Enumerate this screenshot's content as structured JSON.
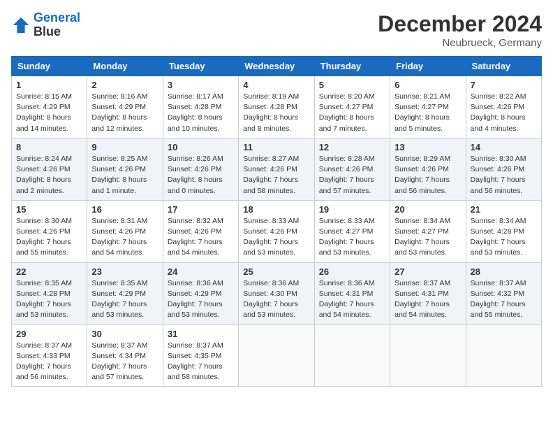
{
  "header": {
    "logo_line1": "General",
    "logo_line2": "Blue",
    "title": "December 2024",
    "subtitle": "Neubrueck, Germany"
  },
  "days_of_week": [
    "Sunday",
    "Monday",
    "Tuesday",
    "Wednesday",
    "Thursday",
    "Friday",
    "Saturday"
  ],
  "weeks": [
    [
      {
        "day": "1",
        "sunrise": "8:15 AM",
        "sunset": "4:29 PM",
        "daylight": "8 hours and 14 minutes."
      },
      {
        "day": "2",
        "sunrise": "8:16 AM",
        "sunset": "4:29 PM",
        "daylight": "8 hours and 12 minutes."
      },
      {
        "day": "3",
        "sunrise": "8:17 AM",
        "sunset": "4:28 PM",
        "daylight": "8 hours and 10 minutes."
      },
      {
        "day": "4",
        "sunrise": "8:19 AM",
        "sunset": "4:28 PM",
        "daylight": "8 hours and 8 minutes."
      },
      {
        "day": "5",
        "sunrise": "8:20 AM",
        "sunset": "4:27 PM",
        "daylight": "8 hours and 7 minutes."
      },
      {
        "day": "6",
        "sunrise": "8:21 AM",
        "sunset": "4:27 PM",
        "daylight": "8 hours and 5 minutes."
      },
      {
        "day": "7",
        "sunrise": "8:22 AM",
        "sunset": "4:26 PM",
        "daylight": "8 hours and 4 minutes."
      }
    ],
    [
      {
        "day": "8",
        "sunrise": "8:24 AM",
        "sunset": "4:26 PM",
        "daylight": "8 hours and 2 minutes."
      },
      {
        "day": "9",
        "sunrise": "8:25 AM",
        "sunset": "4:26 PM",
        "daylight": "8 hours and 1 minute."
      },
      {
        "day": "10",
        "sunrise": "8:26 AM",
        "sunset": "4:26 PM",
        "daylight": "8 hours and 0 minutes."
      },
      {
        "day": "11",
        "sunrise": "8:27 AM",
        "sunset": "4:26 PM",
        "daylight": "7 hours and 58 minutes."
      },
      {
        "day": "12",
        "sunrise": "8:28 AM",
        "sunset": "4:26 PM",
        "daylight": "7 hours and 57 minutes."
      },
      {
        "day": "13",
        "sunrise": "8:29 AM",
        "sunset": "4:26 PM",
        "daylight": "7 hours and 56 minutes."
      },
      {
        "day": "14",
        "sunrise": "8:30 AM",
        "sunset": "4:26 PM",
        "daylight": "7 hours and 56 minutes."
      }
    ],
    [
      {
        "day": "15",
        "sunrise": "8:30 AM",
        "sunset": "4:26 PM",
        "daylight": "7 hours and 55 minutes."
      },
      {
        "day": "16",
        "sunrise": "8:31 AM",
        "sunset": "4:26 PM",
        "daylight": "7 hours and 54 minutes."
      },
      {
        "day": "17",
        "sunrise": "8:32 AM",
        "sunset": "4:26 PM",
        "daylight": "7 hours and 54 minutes."
      },
      {
        "day": "18",
        "sunrise": "8:33 AM",
        "sunset": "4:26 PM",
        "daylight": "7 hours and 53 minutes."
      },
      {
        "day": "19",
        "sunrise": "8:33 AM",
        "sunset": "4:27 PM",
        "daylight": "7 hours and 53 minutes."
      },
      {
        "day": "20",
        "sunrise": "8:34 AM",
        "sunset": "4:27 PM",
        "daylight": "7 hours and 53 minutes."
      },
      {
        "day": "21",
        "sunrise": "8:34 AM",
        "sunset": "4:28 PM",
        "daylight": "7 hours and 53 minutes."
      }
    ],
    [
      {
        "day": "22",
        "sunrise": "8:35 AM",
        "sunset": "4:28 PM",
        "daylight": "7 hours and 53 minutes."
      },
      {
        "day": "23",
        "sunrise": "8:35 AM",
        "sunset": "4:29 PM",
        "daylight": "7 hours and 53 minutes."
      },
      {
        "day": "24",
        "sunrise": "8:36 AM",
        "sunset": "4:29 PM",
        "daylight": "7 hours and 53 minutes."
      },
      {
        "day": "25",
        "sunrise": "8:36 AM",
        "sunset": "4:30 PM",
        "daylight": "7 hours and 53 minutes."
      },
      {
        "day": "26",
        "sunrise": "8:36 AM",
        "sunset": "4:31 PM",
        "daylight": "7 hours and 54 minutes."
      },
      {
        "day": "27",
        "sunrise": "8:37 AM",
        "sunset": "4:31 PM",
        "daylight": "7 hours and 54 minutes."
      },
      {
        "day": "28",
        "sunrise": "8:37 AM",
        "sunset": "4:32 PM",
        "daylight": "7 hours and 55 minutes."
      }
    ],
    [
      {
        "day": "29",
        "sunrise": "8:37 AM",
        "sunset": "4:33 PM",
        "daylight": "7 hours and 56 minutes."
      },
      {
        "day": "30",
        "sunrise": "8:37 AM",
        "sunset": "4:34 PM",
        "daylight": "7 hours and 57 minutes."
      },
      {
        "day": "31",
        "sunrise": "8:37 AM",
        "sunset": "4:35 PM",
        "daylight": "7 hours and 58 minutes."
      },
      null,
      null,
      null,
      null
    ]
  ],
  "labels": {
    "sunrise": "Sunrise:",
    "sunset": "Sunset:",
    "daylight": "Daylight:"
  }
}
